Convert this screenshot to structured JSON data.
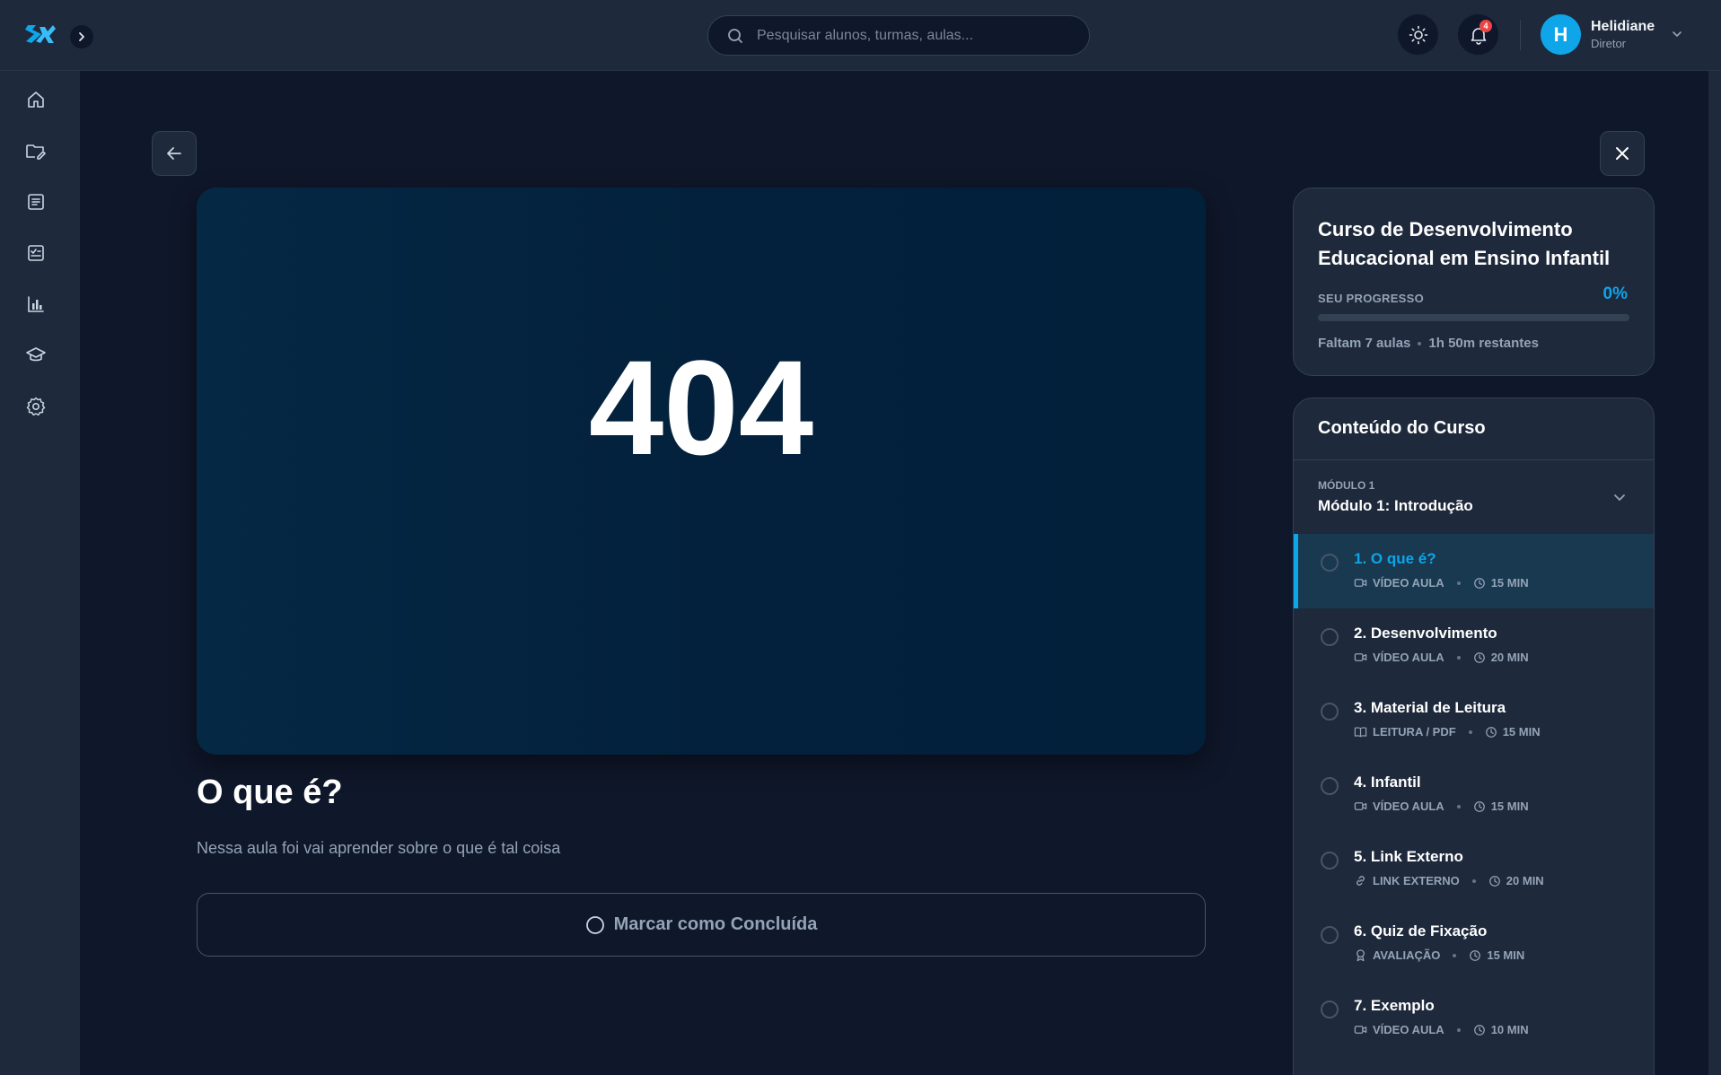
{
  "header": {
    "search_placeholder": "Pesquisar alunos, turmas, aulas...",
    "notification_count": "4",
    "user": {
      "initial": "H",
      "name": "Helidiane",
      "role": "Diretor"
    }
  },
  "sidebar": {
    "items": [
      {
        "icon": "home-icon",
        "name": "sidebar-item-home"
      },
      {
        "icon": "folder-edit-icon",
        "name": "sidebar-item-folders"
      },
      {
        "icon": "list-icon",
        "name": "sidebar-item-list"
      },
      {
        "icon": "checklist-icon",
        "name": "sidebar-item-tasks"
      },
      {
        "icon": "bar-chart-icon",
        "name": "sidebar-item-reports"
      },
      {
        "icon": "graduation-cap-icon",
        "name": "sidebar-item-courses"
      },
      {
        "icon": "gear-icon",
        "name": "sidebar-item-settings"
      }
    ]
  },
  "player": {
    "error_code": "404"
  },
  "lesson": {
    "title": "O que é?",
    "description": "Nessa aula foi vai aprender sobre o que é tal coisa",
    "complete_label": "Marcar como Concluída"
  },
  "progress": {
    "course_title": "Curso de Desenvolvimento Educacional em Ensino Infantil",
    "label": "SEU PROGRESSO",
    "percent_text": "0%",
    "percent": 0,
    "remaining_lessons": "Faltam 7 aulas",
    "remaining_time": "1h 50m restantes"
  },
  "content": {
    "title": "Conteúdo do Curso",
    "module": {
      "label": "MÓDULO 1",
      "title": "Módulo 1: Introdução"
    },
    "lessons": [
      {
        "name": "1. O que é?",
        "type": "VÍDEO AULA",
        "type_icon": "video-icon",
        "duration": "15 MIN",
        "active": true
      },
      {
        "name": "2. Desenvolvimento",
        "type": "VÍDEO AULA",
        "type_icon": "video-icon",
        "duration": "20 MIN",
        "active": false
      },
      {
        "name": "3. Material de Leitura",
        "type": "LEITURA / PDF",
        "type_icon": "book-icon",
        "duration": "15 MIN",
        "active": false
      },
      {
        "name": "4. Infantil",
        "type": "VÍDEO AULA",
        "type_icon": "video-icon",
        "duration": "15 MIN",
        "active": false
      },
      {
        "name": "5. Link Externo",
        "type": "LINK EXTERNO",
        "type_icon": "link-icon",
        "duration": "20 MIN",
        "active": false
      },
      {
        "name": "6. Quiz de Fixação",
        "type": "AVALIAÇÃO",
        "type_icon": "award-icon",
        "duration": "15 MIN",
        "active": false
      },
      {
        "name": "7. Exemplo",
        "type": "VÍDEO AULA",
        "type_icon": "video-icon",
        "duration": "10 MIN",
        "active": false
      }
    ]
  },
  "colors": {
    "accent": "#0ea5e9",
    "background": "#0f172a",
    "surface": "#1e293b",
    "badge": "#ef4444"
  }
}
